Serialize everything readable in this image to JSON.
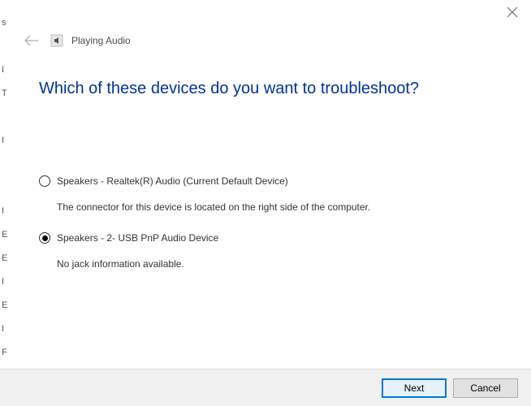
{
  "header": {
    "title": "Playing Audio"
  },
  "main": {
    "heading": "Which of these devices do you want to troubleshoot?"
  },
  "devices": [
    {
      "label": "Speakers - Realtek(R) Audio (Current Default Device)",
      "description": "The connector for this device is located on the right side of the computer.",
      "selected": false
    },
    {
      "label": "Speakers - 2- USB PnP Audio Device",
      "description": "No jack information available.",
      "selected": true
    }
  ],
  "footer": {
    "next_label": "Next",
    "cancel_label": "Cancel"
  },
  "sidebar_letters": "s\n\nI\nT\n\nI\n\n\nI\nE\nE\nI\nE\nI\nF"
}
